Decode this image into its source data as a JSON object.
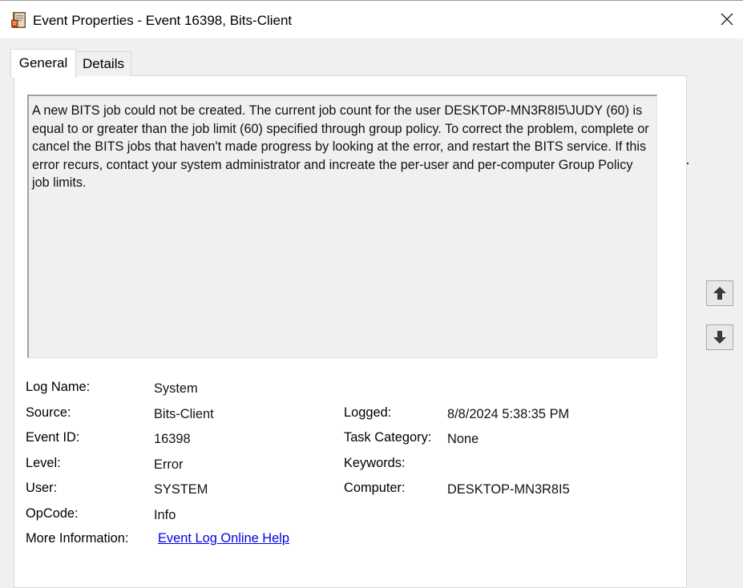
{
  "window": {
    "title": "Event Properties - Event 16398, Bits-Client"
  },
  "tabs": {
    "general": "General",
    "details": "Details"
  },
  "description": "A new BITS job could not be created. The current job count for the user DESKTOP-MN3R8I5\\JUDY (60) is equal to or greater than the job limit (60) specified through group policy.  To correct the problem, complete or cancel the BITS jobs that haven't made progress by looking at the error, and restart the BITS service. If this error recurs, contact your system administrator and increate the per-user and per-computer Group Policy job limits.",
  "fields": {
    "log_name_label": "Log Name:",
    "log_name": "System",
    "source_label": "Source:",
    "source": "Bits-Client",
    "event_id_label": "Event ID:",
    "event_id": "16398",
    "level_label": "Level:",
    "level": "Error",
    "user_label": "User:",
    "user": "SYSTEM",
    "opcode_label": "OpCode:",
    "opcode": "Info",
    "more_info_label": "More Information:",
    "more_info_link": "Event Log Online Help",
    "logged_label": "Logged:",
    "logged": "8/8/2024 5:38:35 PM",
    "task_category_label": "Task Category:",
    "task_category": "None",
    "keywords_label": "Keywords:",
    "keywords": "",
    "computer_label": "Computer:",
    "computer": "DESKTOP-MN3R8I5"
  },
  "icons": {
    "app": "event-viewer-icon",
    "close": "close-icon",
    "up": "arrow-up-icon",
    "down": "arrow-down-icon"
  }
}
